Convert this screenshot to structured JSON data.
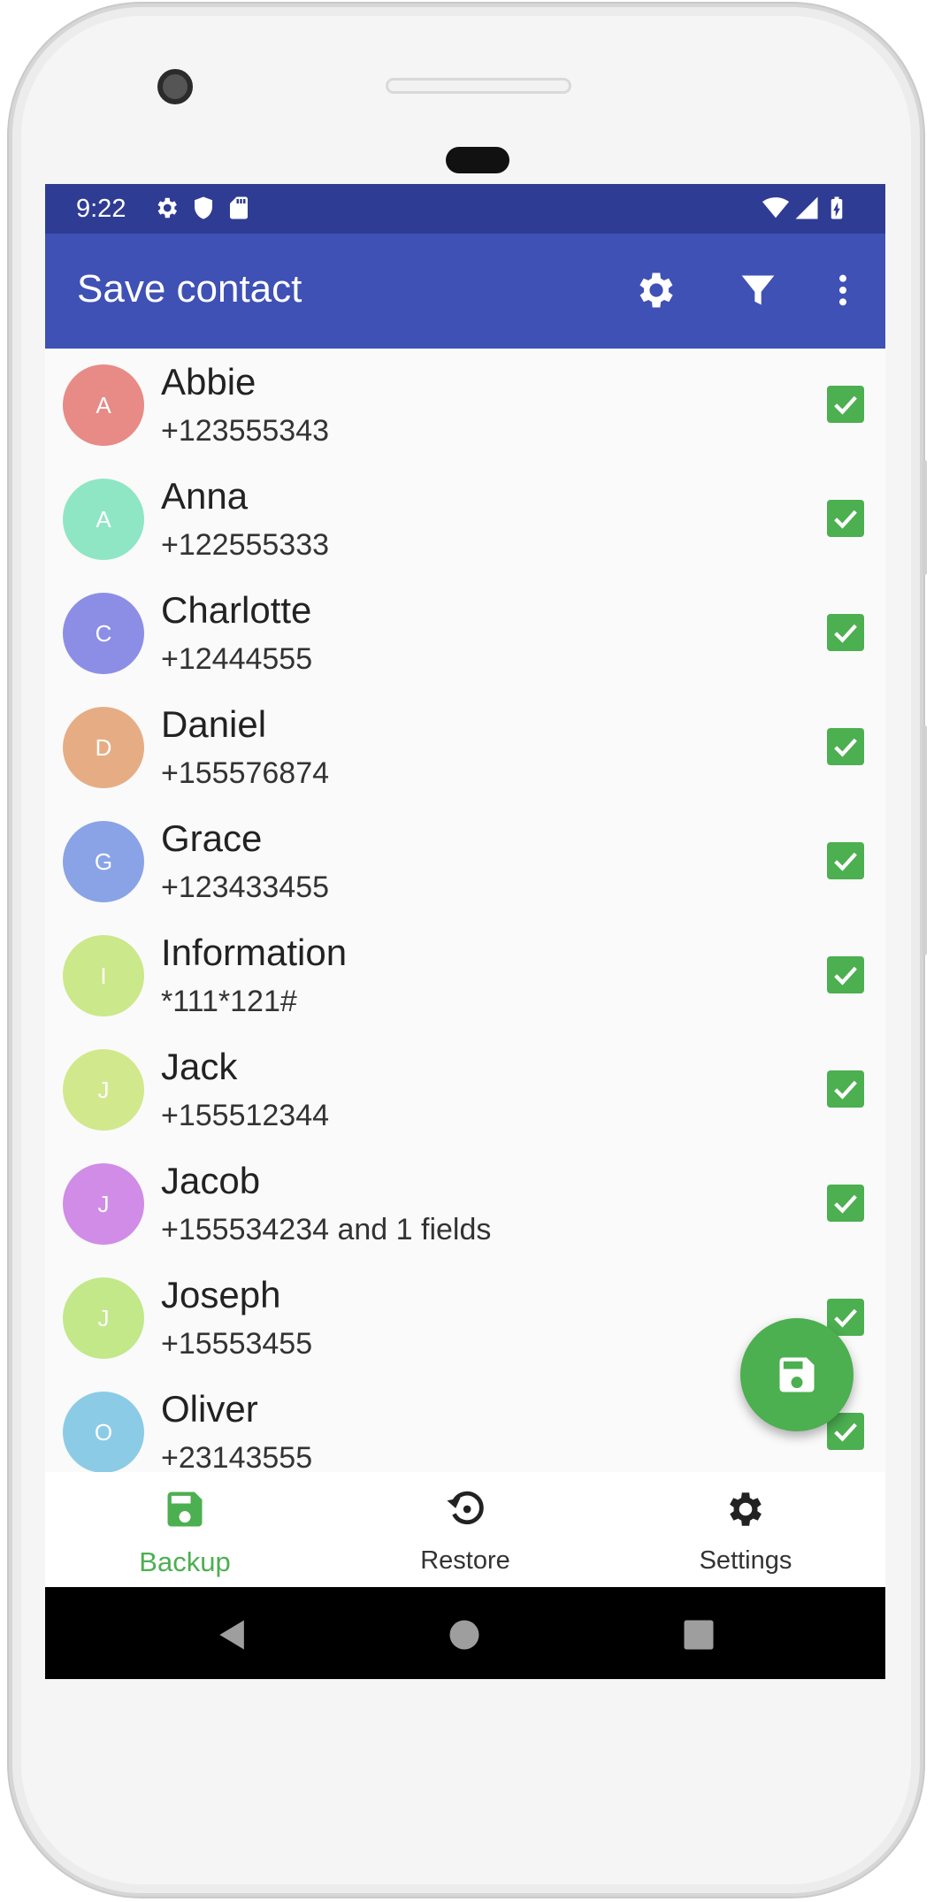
{
  "status_bar": {
    "time": "9:22",
    "background": "#2f3c94",
    "left_icons": [
      "gear-icon",
      "shield-icon",
      "sd-card-icon"
    ],
    "right_icons": [
      "wifi-icon",
      "signal-icon",
      "battery-charging-icon"
    ]
  },
  "app_bar": {
    "title": "Save contact",
    "background": "#3f51b5",
    "actions": [
      "settings-icon",
      "filter-icon",
      "more-vertical-icon"
    ]
  },
  "contacts": [
    {
      "initial": "A",
      "name": "Abbie",
      "phone": "+123555343",
      "color": "#e88a85",
      "checked": true
    },
    {
      "initial": "A",
      "name": "Anna",
      "phone": "+122555333",
      "color": "#8fe6c4",
      "checked": true
    },
    {
      "initial": "C",
      "name": "Charlotte",
      "phone": "+12444555",
      "color": "#8c8ee6",
      "checked": true
    },
    {
      "initial": "D",
      "name": "Daniel",
      "phone": "+155576874",
      "color": "#e6ad85",
      "checked": true
    },
    {
      "initial": "G",
      "name": "Grace",
      "phone": "+123433455",
      "color": "#8aa3e6",
      "checked": true
    },
    {
      "initial": "I",
      "name": "Information",
      "phone": "*111*121#",
      "color": "#cbe88a",
      "checked": true
    },
    {
      "initial": "J",
      "name": "Jack",
      "phone": "+155512344",
      "color": "#d2e88c",
      "checked": true
    },
    {
      "initial": "J",
      "name": "Jacob",
      "phone": "+155534234 and 1 fields",
      "color": "#d08ce6",
      "checked": true
    },
    {
      "initial": "J",
      "name": "Joseph",
      "phone": "+15553455",
      "color": "#c2e88a",
      "checked": true
    },
    {
      "initial": "O",
      "name": "Oliver",
      "phone": "+23143555",
      "color": "#8ccbe6",
      "checked": true
    }
  ],
  "fab": {
    "icon": "save-icon",
    "color": "#4caf50"
  },
  "bottom_nav": [
    {
      "label": "Backup",
      "icon": "save-icon",
      "active": true
    },
    {
      "label": "Restore",
      "icon": "restore-icon",
      "active": false
    },
    {
      "label": "Settings",
      "icon": "settings-icon",
      "active": false
    }
  ],
  "accent": "#4caf50"
}
